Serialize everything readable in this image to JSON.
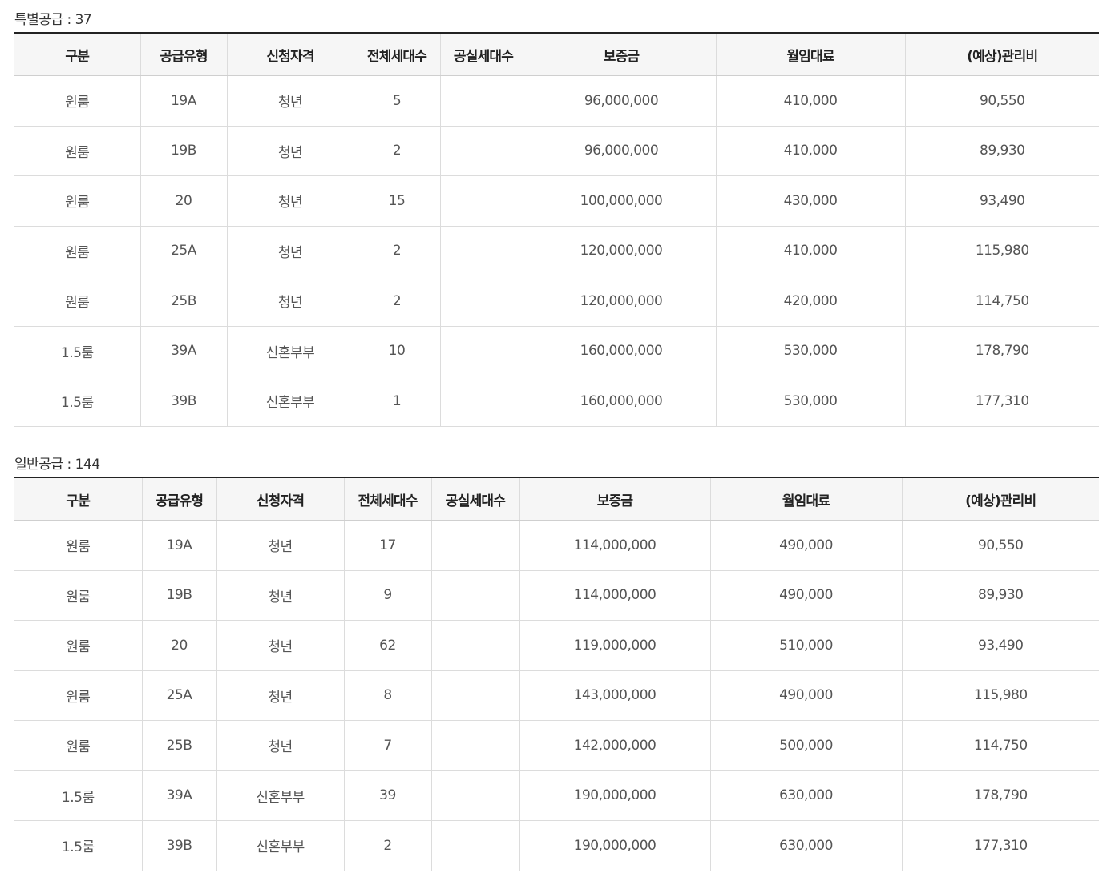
{
  "tables": [
    {
      "title": "특별공급 : 37",
      "headers": [
        "구분",
        "공급유형",
        "신청자격",
        "전체세대수",
        "공실세대수",
        "보증금",
        "월임대료",
        "(예상)관리비"
      ],
      "rows": [
        [
          "원룸",
          "19A",
          "청년",
          "5",
          "",
          "96,000,000",
          "410,000",
          "90,550"
        ],
        [
          "원룸",
          "19B",
          "청년",
          "2",
          "",
          "96,000,000",
          "410,000",
          "89,930"
        ],
        [
          "원룸",
          "20",
          "청년",
          "15",
          "",
          "100,000,000",
          "430,000",
          "93,490"
        ],
        [
          "원룸",
          "25A",
          "청년",
          "2",
          "",
          "120,000,000",
          "410,000",
          "115,980"
        ],
        [
          "원룸",
          "25B",
          "청년",
          "2",
          "",
          "120,000,000",
          "420,000",
          "114,750"
        ],
        [
          "1.5룸",
          "39A",
          "신혼부부",
          "10",
          "",
          "160,000,000",
          "530,000",
          "178,790"
        ],
        [
          "1.5룸",
          "39B",
          "신혼부부",
          "1",
          "",
          "160,000,000",
          "530,000",
          "177,310"
        ]
      ]
    },
    {
      "title": "일반공급 : 144",
      "headers": [
        "구분",
        "공급유형",
        "신청자격",
        "전체세대수",
        "공실세대수",
        "보증금",
        "월임대료",
        "(예상)관리비"
      ],
      "rows": [
        [
          "원룸",
          "19A",
          "청년",
          "17",
          "",
          "114,000,000",
          "490,000",
          "90,550"
        ],
        [
          "원룸",
          "19B",
          "청년",
          "9",
          "",
          "114,000,000",
          "490,000",
          "89,930"
        ],
        [
          "원룸",
          "20",
          "청년",
          "62",
          "",
          "119,000,000",
          "510,000",
          "93,490"
        ],
        [
          "원룸",
          "25A",
          "청년",
          "8",
          "",
          "143,000,000",
          "490,000",
          "115,980"
        ],
        [
          "원룸",
          "25B",
          "청년",
          "7",
          "",
          "142,000,000",
          "500,000",
          "114,750"
        ],
        [
          "1.5룸",
          "39A",
          "신혼부부",
          "39",
          "",
          "190,000,000",
          "630,000",
          "178,790"
        ],
        [
          "1.5룸",
          "39B",
          "신혼부부",
          "2",
          "",
          "190,000,000",
          "630,000",
          "177,310"
        ]
      ]
    }
  ]
}
